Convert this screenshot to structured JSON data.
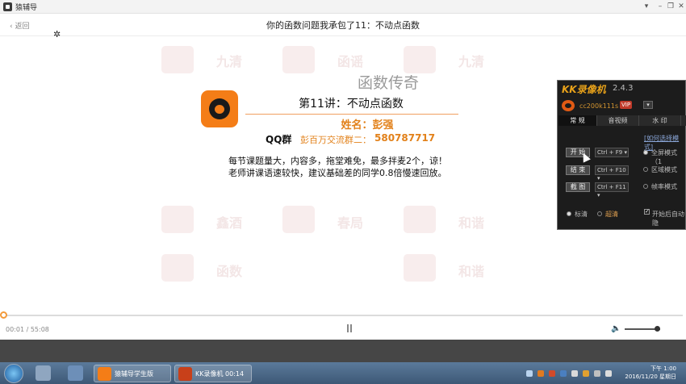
{
  "window": {
    "title": "猿辅导",
    "controls": [
      "▾",
      "–",
      "❐",
      "✕"
    ]
  },
  "header": {
    "back_label": "返回",
    "title": "你的函数问题我承包了11：不动点函数",
    "cursor_glyph": "✲"
  },
  "slide": {
    "course_name": "函数传奇",
    "lecture": "第11讲：不动点函数",
    "teacher": "姓名：彭强",
    "qq_label": "QQ群",
    "qq_group_name": "彭百万交流群二：",
    "qq_number": "580787717",
    "notice_line1": "每节课题量大，内容多，拖堂难免，最多拌麦2个，谅！",
    "notice_line2": "老师讲课语速较快，建议基础差的同学0.8倍慢速回放。",
    "watermark_text": [
      "九清",
      "函谣",
      "九清",
      "鑫酒",
      "春局",
      "和谐",
      "函数",
      "和谐"
    ],
    "colors": {
      "logo": "#f47d17",
      "accent": "#e2811a"
    }
  },
  "player": {
    "time": "00:01 / 55:08",
    "progress": 0.0003,
    "volume": 0.9,
    "volume_icon": "🔈"
  },
  "kk": {
    "title": "KK录像机",
    "version": "2.4.3",
    "user": "cc200k111s",
    "vip": "VIP",
    "menu_glyph": "▾",
    "tabs": [
      "常 规",
      "音视频",
      "水 印"
    ],
    "link": "[如何选择模式]",
    "buttons": [
      {
        "label": "开 始",
        "key": "Ctrl + F9"
      },
      {
        "label": "结 束",
        "key": "Ctrl + F10"
      },
      {
        "label": "截 图",
        "key": "Ctrl + F11"
      }
    ],
    "dropdown_glyph": "▾",
    "modes": [
      "全屏模式（1",
      "区域模式",
      "帧率模式"
    ],
    "quality": [
      "标清",
      "超清"
    ],
    "auto_hide": "开始后自动隐",
    "checkmark": "✓"
  },
  "taskbar": {
    "tasks": [
      "猿辅导学生版",
      "KK录像机 00:14"
    ],
    "clock_time": "下午 1:00",
    "clock_date": "2016/11/20 星期日"
  }
}
